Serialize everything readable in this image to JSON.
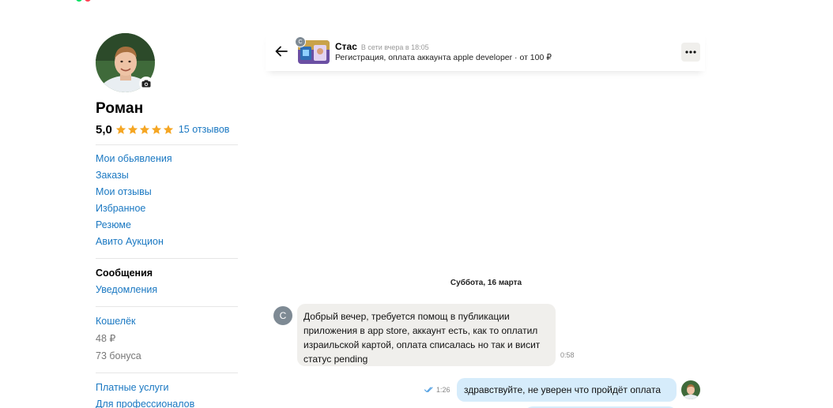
{
  "profile": {
    "name": "Роман",
    "rating": "5,0",
    "reviews_link": "15 отзывов",
    "menu_primary": [
      "Мои обьявления",
      "Заказы",
      "Мои отзывы",
      "Избранное",
      "Резюме",
      "Авито Аукцион"
    ],
    "menu_messages": {
      "active": "Сообщения",
      "notifications": "Уведомления"
    },
    "wallet": {
      "label": "Кошелёк",
      "balance": "48 ₽",
      "bonus": "73 бонуса"
    },
    "menu_services": [
      "Платные услуги",
      "Для профессионалов"
    ]
  },
  "chat": {
    "header": {
      "contact_name": "Стас",
      "contact_initial": "С",
      "status": "В сети вчера в 18:05",
      "item_title": "Регистрация, оплата аккаунта apple developer · от 100 ₽"
    },
    "date_separator": "Суббота, 16 марта",
    "messages": [
      {
        "direction": "incoming",
        "sender_initial": "С",
        "text": "Добрый вечер, требуется помощ в публикации приложения в app store, аккаунт есть, как то оплатил израильской картой, оплата списалась но так и висит статус pending",
        "time": "0:58"
      },
      {
        "direction": "outgoing",
        "text": "здравствуйте, не уверен что пройдёт оплата",
        "time": "1:26",
        "status_icon": "double-check-icon"
      }
    ]
  },
  "icons": {
    "star": "star-icon",
    "camera": "camera-icon",
    "back": "arrow-left-icon",
    "more": "more-dots-icon"
  },
  "colors": {
    "link": "#1a78c2",
    "star": "#f5a623",
    "incoming_bubble": "#f0efec",
    "outgoing_bubble": "#d6ecfb",
    "avatar_gray": "#7e8a94"
  }
}
